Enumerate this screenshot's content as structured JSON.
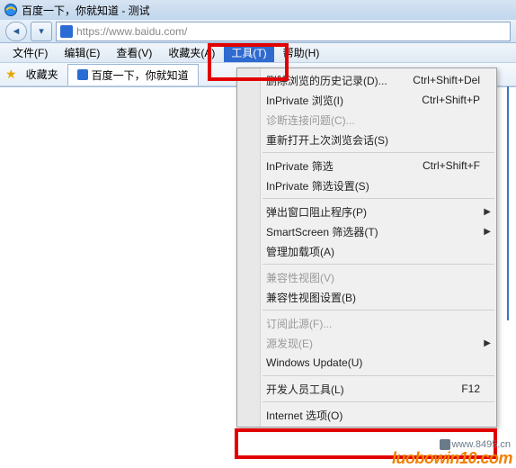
{
  "titlebar": {
    "text": "百度一下，你就知道 - 测试"
  },
  "url": "https://www.baidu.com/",
  "menubar": {
    "file": "文件(F)",
    "edit": "编辑(E)",
    "view": "查看(V)",
    "favorites": "收藏夹(A)",
    "tools": "工具(T)",
    "help": "帮助(H)"
  },
  "bookbar": {
    "fav_label": "收藏夹",
    "tab_title": "百度一下，你就知道"
  },
  "menu": {
    "items": [
      {
        "label": "删除浏览的历史记录(D)...",
        "shortcut": "Ctrl+Shift+Del"
      },
      {
        "label": "InPrivate 浏览(I)",
        "shortcut": "Ctrl+Shift+P"
      },
      {
        "label": "诊断连接问题(C)...",
        "disabled": true
      },
      {
        "label": "重新打开上次浏览会话(S)"
      },
      {
        "sep": true
      },
      {
        "label": "InPrivate 筛选",
        "shortcut": "Ctrl+Shift+F"
      },
      {
        "label": "InPrivate 筛选设置(S)"
      },
      {
        "sep": true
      },
      {
        "label": "弹出窗口阻止程序(P)",
        "submenu": true
      },
      {
        "label": "SmartScreen 筛选器(T)",
        "submenu": true
      },
      {
        "label": "管理加载项(A)"
      },
      {
        "sep": true
      },
      {
        "label": "兼容性视图(V)",
        "disabled": true
      },
      {
        "label": "兼容性视图设置(B)"
      },
      {
        "sep": true
      },
      {
        "label": "订阅此源(F)...",
        "disabled": true
      },
      {
        "label": "源发现(E)",
        "submenu": true,
        "disabled": true
      },
      {
        "label": "Windows Update(U)"
      },
      {
        "sep": true
      },
      {
        "label": "开发人员工具(L)",
        "shortcut": "F12"
      },
      {
        "sep": true
      },
      {
        "label": "Internet 选项(O)"
      }
    ]
  },
  "watermark": "luobowin10.com",
  "watermark2": "www.8495.cn"
}
